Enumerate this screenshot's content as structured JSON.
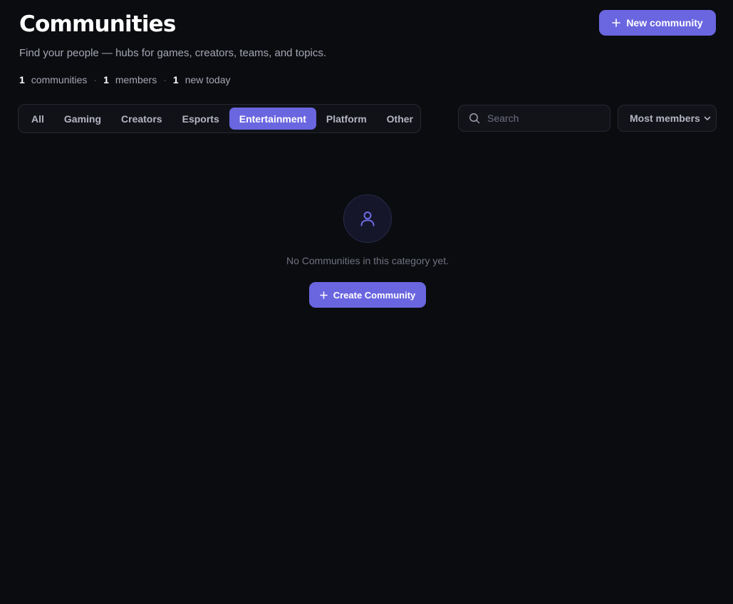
{
  "header": {
    "title": "Communities",
    "subtitle": "Find your people — hubs for games, creators, teams, and topics.",
    "new_button_label": "New community",
    "new_button_icon": "plus-icon"
  },
  "stats": {
    "communities_count": "1",
    "communities_label": "communities",
    "members_count": "1",
    "members_label": "members",
    "new_today_count": "1",
    "new_today_label": "new today",
    "separator": "·"
  },
  "tabs": [
    {
      "label": "All",
      "active": false
    },
    {
      "label": "Gaming",
      "active": false
    },
    {
      "label": "Creators",
      "active": false
    },
    {
      "label": "Esports",
      "active": false
    },
    {
      "label": "Entertainment",
      "active": true
    },
    {
      "label": "Platform",
      "active": false
    },
    {
      "label": "Other",
      "active": false
    }
  ],
  "search": {
    "placeholder": "Search",
    "value": "",
    "icon": "search-icon"
  },
  "sort": {
    "selected": "Most members",
    "icon": "chevron-down-icon"
  },
  "empty_state": {
    "icon": "user-icon",
    "message": "No Communities in this category yet.",
    "button_label": "Create Community",
    "button_icon": "plus-icon"
  },
  "colors": {
    "background": "#0b0c10",
    "accent": "#6a66e0",
    "panel_border": "#262831",
    "muted_text": "#a4a7b3"
  }
}
